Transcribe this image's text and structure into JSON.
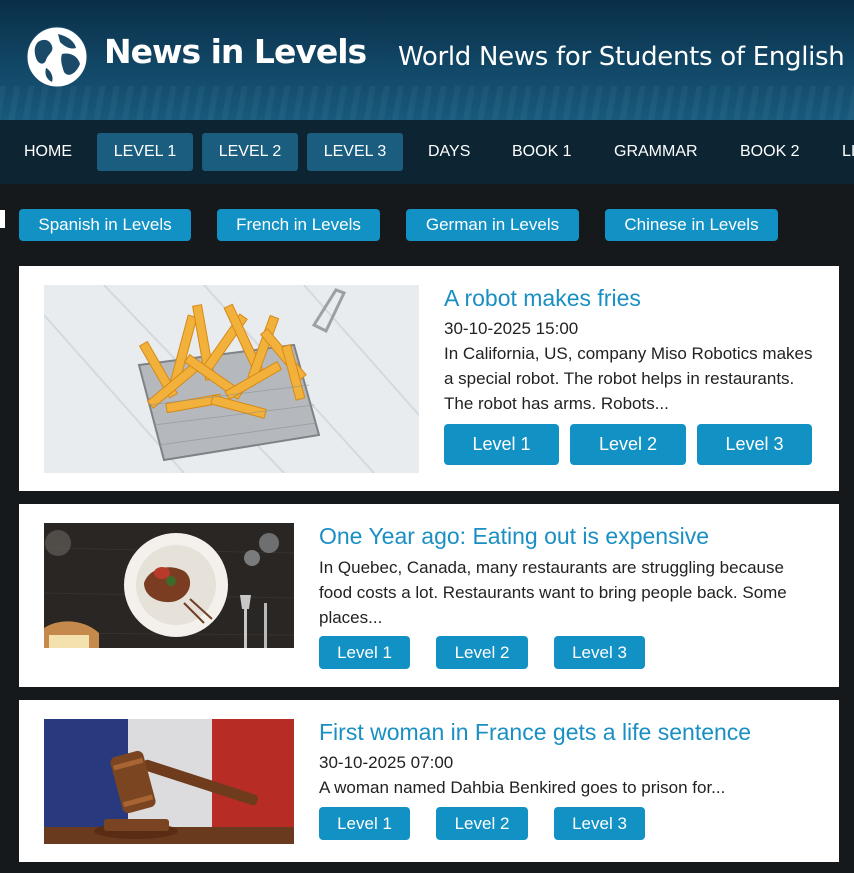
{
  "header": {
    "logo_text": "News in Levels",
    "tagline": "World News for Students of English"
  },
  "nav": [
    {
      "label": "HOME"
    },
    {
      "label": "LEVEL 1"
    },
    {
      "label": "LEVEL 2"
    },
    {
      "label": "LEVEL 3"
    },
    {
      "label": "DAYS"
    },
    {
      "label": "BOOK 1"
    },
    {
      "label": "GRAMMAR"
    },
    {
      "label": "BOOK 2"
    },
    {
      "label": "LI"
    }
  ],
  "languages": [
    {
      "label": "Spanish in Levels"
    },
    {
      "label": "French in Levels"
    },
    {
      "label": "German in Levels"
    },
    {
      "label": "Chinese in Levels"
    }
  ],
  "articles": [
    {
      "title": "A robot makes fries",
      "date": "30-10-2025 15:00",
      "excerpt": "In California, US, company Miso Robotics makes a special robot. The robot helps in restaurants. The robot has arms. Robots...",
      "buttons": [
        "Level 1",
        "Level 2",
        "Level 3"
      ]
    },
    {
      "title": "One Year ago: Eating out is expensive",
      "excerpt": "In Quebec, Canada, many restaurants are struggling because food costs a lot. Restaurants want to bring people back. Some places...",
      "buttons": [
        "Level 1",
        "Level 2",
        "Level 3"
      ]
    },
    {
      "title": "First woman in France gets a life sentence",
      "date": "30-10-2025 07:00",
      "excerpt": "A woman named Dahbia Benkired goes to prison for...",
      "buttons": [
        "Level 1",
        "Level 2",
        "Level 3"
      ]
    }
  ],
  "colors": {
    "accent": "#1291c4",
    "title": "#1a8fc4",
    "nav_bg": "#0d2533",
    "page_bg": "#15191c"
  }
}
